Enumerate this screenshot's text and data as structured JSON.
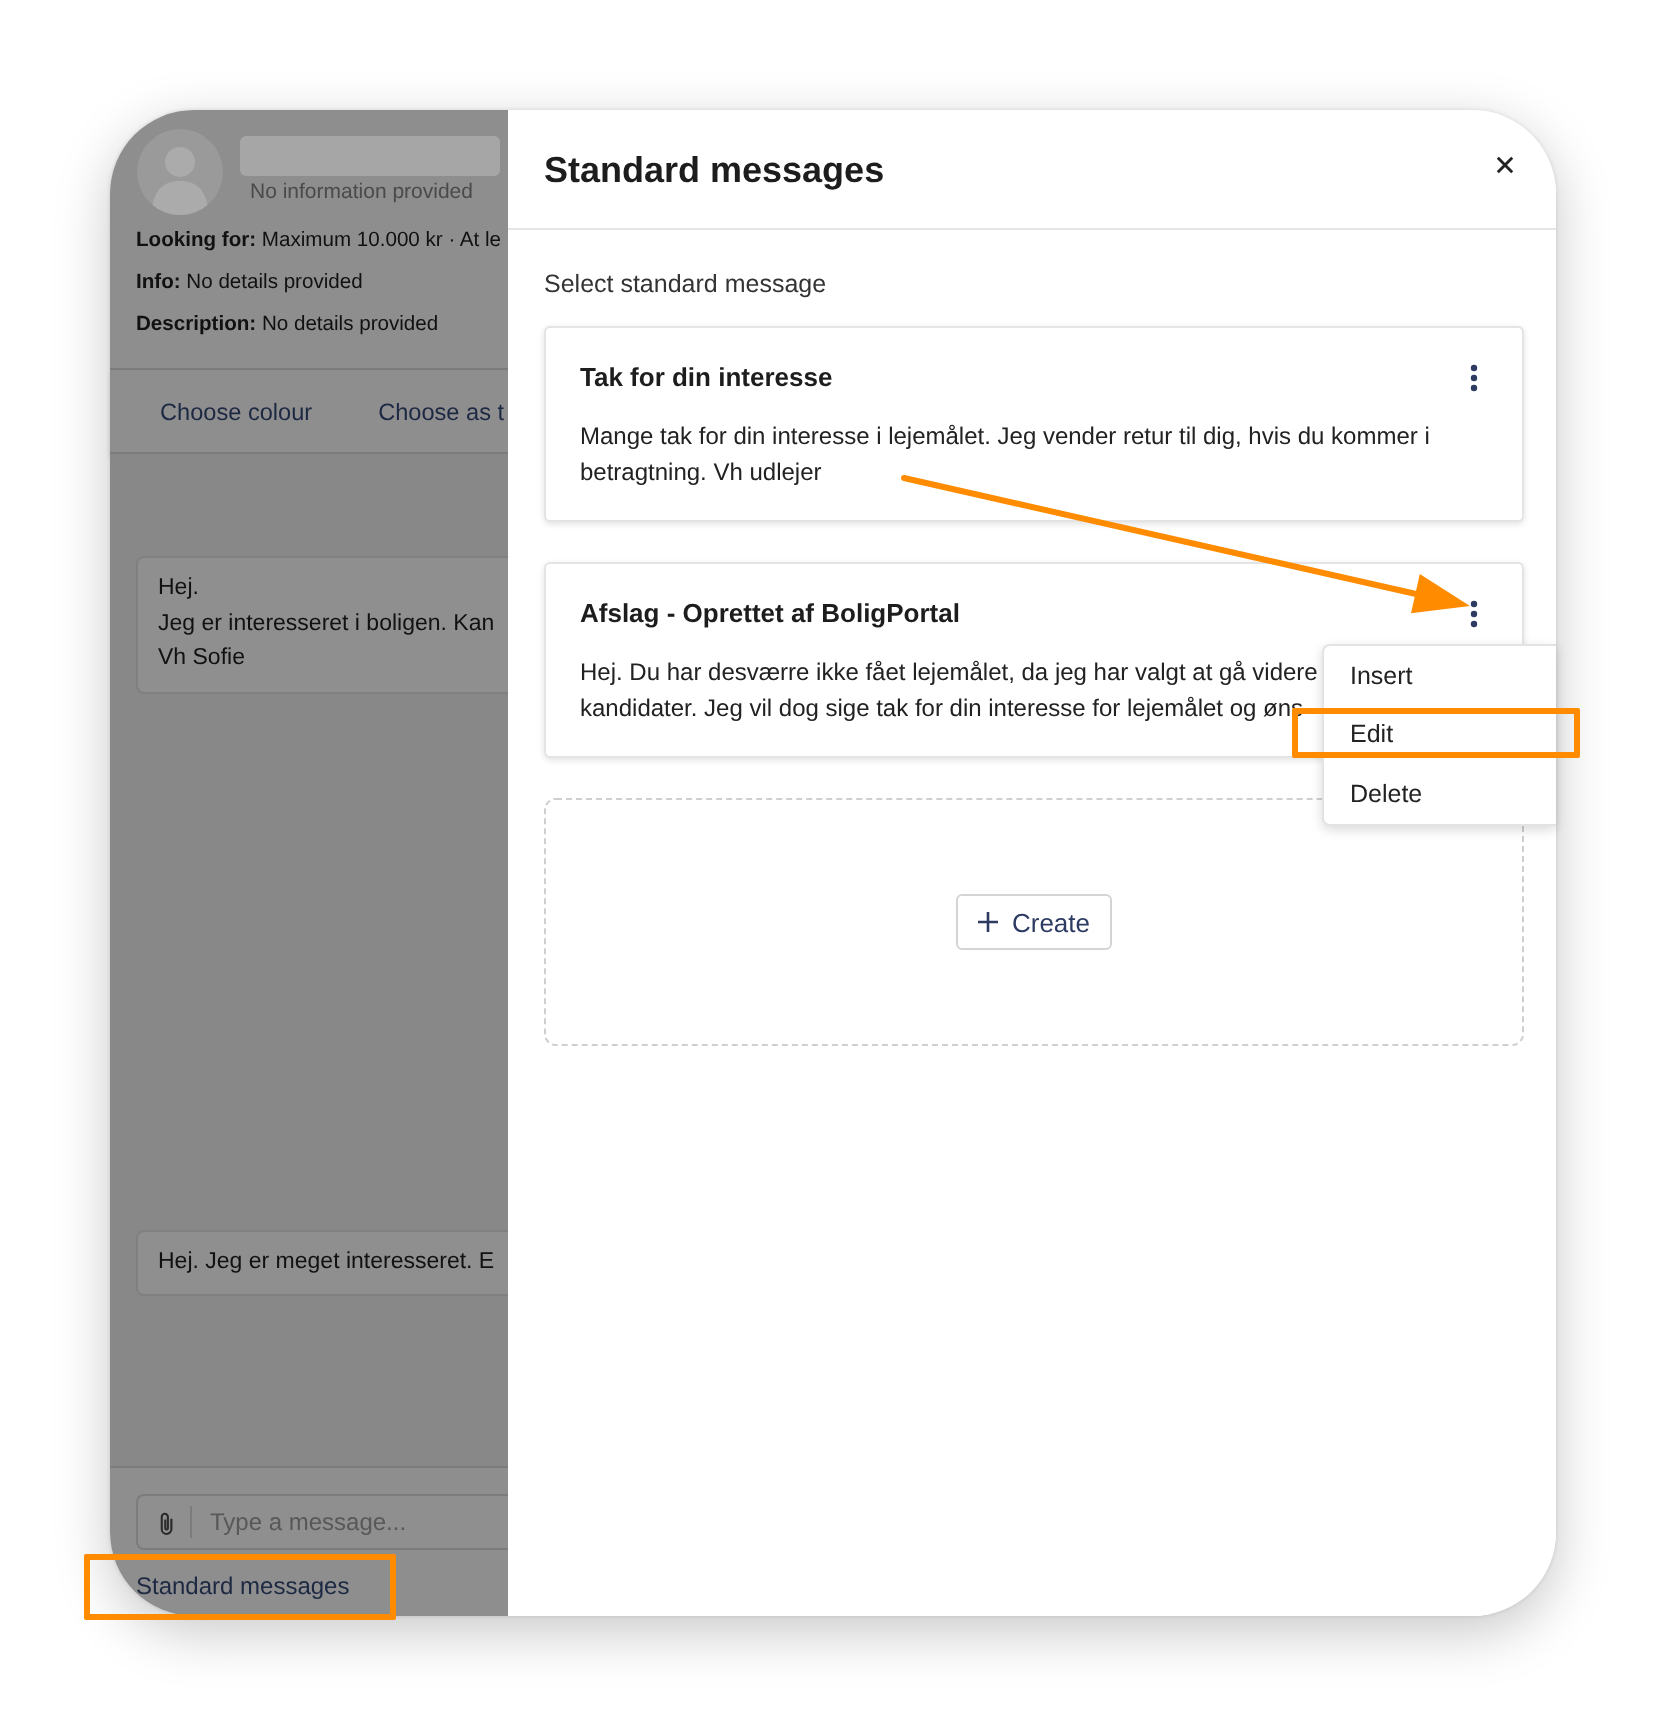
{
  "conversation": {
    "dimmed": true,
    "profile": {
      "status": "No information provided",
      "details": [
        {
          "label": "Looking for:",
          "value": "Maximum 10.000 kr · At le"
        },
        {
          "label": "Info:",
          "value": "No details provided"
        },
        {
          "label": "Description:",
          "value": "No details provided"
        }
      ]
    },
    "actions": [
      "Choose colour",
      "Choose as t"
    ],
    "messages": [
      {
        "lines": [
          "Hej.",
          "Jeg er interesseret i boligen. Kan",
          "Vh Sofie"
        ]
      },
      {
        "lines": [
          "Hej. Jeg er meget interesseret. E"
        ]
      }
    ],
    "composer": {
      "placeholder": "Type a message..."
    },
    "standard_messages_link": {
      "label": "Standard messages",
      "highlighted": true
    }
  },
  "drawer": {
    "title": "Standard messages",
    "subtitle": "Select standard message",
    "templates": [
      {
        "title": "Tak for din interesse",
        "lines": [
          "Mange tak for din interesse i lejemålet. Jeg vender retur til dig, hvis du kommer i",
          "betragtning. Vh udlejer"
        ],
        "pointed_at": false
      },
      {
        "title": "Afslag - Oprettet af BoligPortal",
        "lines": [
          "Hej. Du har desværre ikke fået lejemålet, da jeg har valgt at gå videre",
          "kandidater. Jeg vil dog sige tak for din interesse for lejemålet og øns"
        ],
        "pointed_at": true,
        "menu": {
          "items": [
            {
              "label": "Insert",
              "highlighted": false
            },
            {
              "label": "Edit",
              "highlighted": true
            },
            {
              "label": "Delete",
              "highlighted": false
            }
          ]
        }
      }
    ],
    "create_button": "Create"
  }
}
